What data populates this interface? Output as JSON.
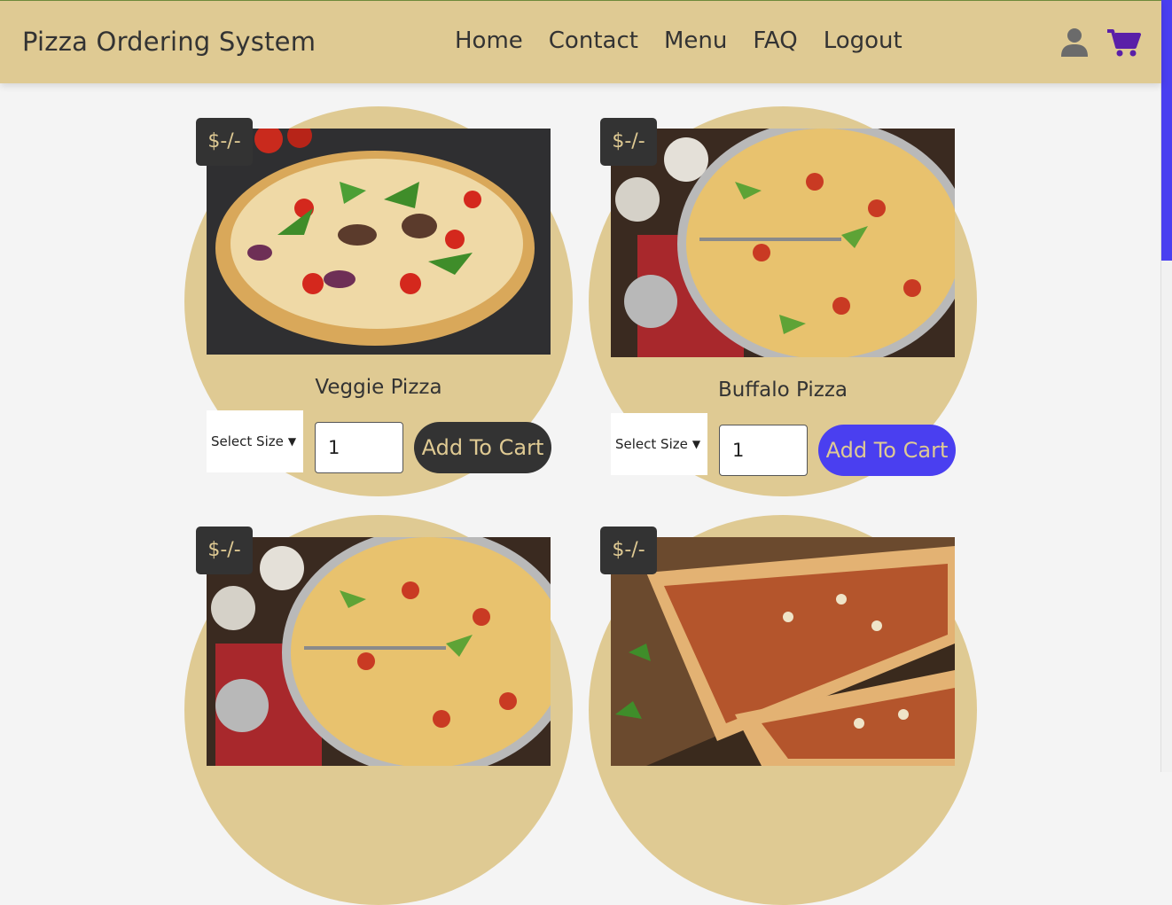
{
  "header": {
    "brand": "Pizza Ordering System",
    "nav": [
      "Home",
      "Contact",
      "Menu",
      "FAQ",
      "Logout"
    ],
    "user_icon": "user-icon",
    "cart_icon": "cart-icon"
  },
  "colors": {
    "header_bg": "#dfca93",
    "card_circle": "#dfca93",
    "badge_bg": "#333333",
    "button_default": "#333333",
    "button_hover": "#4a3ff0",
    "scrollbar_thumb": "#4a3ff0"
  },
  "products": [
    {
      "name": "Veggie Pizza",
      "price": "$-/-",
      "size_placeholder": "Select Size",
      "quantity": "1",
      "button_label": "Add To Cart"
    },
    {
      "name": "Buffalo Pizza",
      "price": "$-/-",
      "size_placeholder": "Select Size",
      "quantity": "1",
      "button_label": "Add To Cart"
    },
    {
      "name": "",
      "price": "$-/-"
    },
    {
      "name": "",
      "price": "$-/-"
    }
  ]
}
